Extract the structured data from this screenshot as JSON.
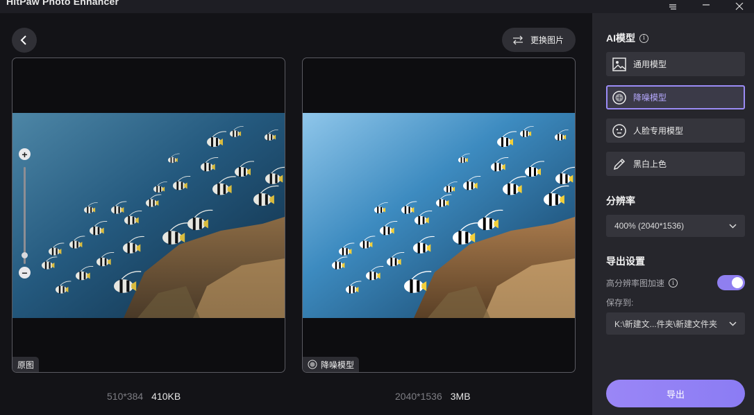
{
  "window": {
    "title": "HitPaw Photo Enhancer",
    "controls": [
      "menu-icon",
      "minimize-icon",
      "close-icon"
    ]
  },
  "toolbar": {
    "replace_label": "更换图片"
  },
  "original": {
    "tag": "原图",
    "dimensions": "510*384",
    "size": "410KB",
    "zoom_level": 0.14
  },
  "enhanced": {
    "tag": "降噪模型",
    "dimensions": "2040*1536",
    "size": "3MB"
  },
  "sidebar": {
    "ai_model_title": "AI模型",
    "models": [
      {
        "label": "通用模型",
        "icon": "image-icon",
        "active": false
      },
      {
        "label": "降噪模型",
        "icon": "denoise-icon",
        "active": true
      },
      {
        "label": "人脸专用模型",
        "icon": "face-icon",
        "active": false
      },
      {
        "label": "黑白上色",
        "icon": "colorize-icon",
        "active": false
      }
    ],
    "resolution_title": "分辨率",
    "resolution_value": "400% (2040*1536)",
    "export_settings_title": "导出设置",
    "hires_label": "高分辨率图加速",
    "hires_enabled": true,
    "save_to_label": "保存到:",
    "save_path": "K:\\新建文...件夹\\新建文件夹",
    "export_label": "导出"
  },
  "colors": {
    "accent": "#8f7ff0",
    "panel": "#35353c",
    "sidebar": "#26262c"
  }
}
